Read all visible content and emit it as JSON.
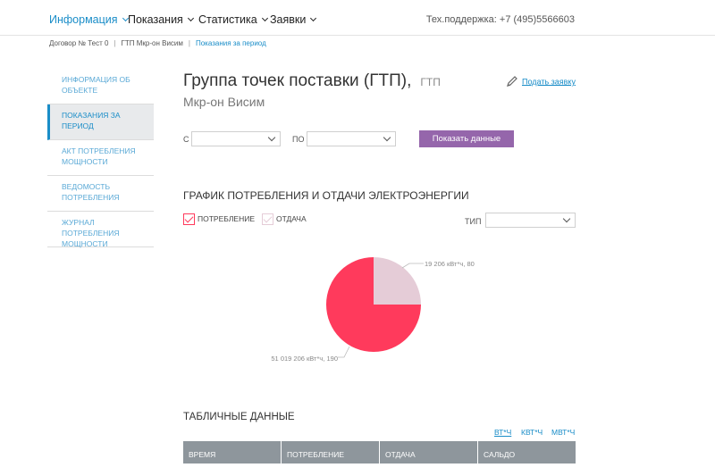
{
  "nav": {
    "items": [
      {
        "label": "Информация",
        "active": true
      },
      {
        "label": "Показания",
        "active": false
      },
      {
        "label": "Статистика",
        "active": false
      },
      {
        "label": "Заявки",
        "active": false
      }
    ],
    "support": "Тех.поддержка: +7 (495)5566603"
  },
  "breadcrumb": [
    "Договор № Тест 0",
    "ГТП Мкр-он Висим",
    "Показания за период"
  ],
  "sidebar": {
    "items": [
      {
        "label": "Информация об объекте"
      },
      {
        "label": "Показания за период"
      },
      {
        "label": "Акт потребления мощности"
      },
      {
        "label": "Ведомость потребления"
      },
      {
        "label": "Журнал потребления мощности"
      }
    ]
  },
  "page": {
    "title": "Группа точек поставки (ГТП),",
    "title_type": "ГТП",
    "subtitle": "Мкр-он Висим",
    "request_link": "Подать заявку"
  },
  "filters": {
    "from_label": "С",
    "to_label": "ПО",
    "from_value": "",
    "to_value": "",
    "show_button": "Показать данные"
  },
  "chart_section": {
    "title": "График потребления и отдачи электроэнергии",
    "legend_consumption": "Потребление",
    "legend_return": "Отдача",
    "type_label": "Тип",
    "type_value": ""
  },
  "chart_data": {
    "type": "pie",
    "slices": [
      {
        "label": "Потребление",
        "value": 51019206,
        "data_label": "51 019 206 кВт*ч, 190",
        "color": "#ff3a5c"
      },
      {
        "label": "Отдача",
        "value": 19206,
        "data_label": "19 206 кВт*ч, 80",
        "color": "#e5ccd7"
      }
    ]
  },
  "table": {
    "title": "Табличные данные",
    "units": [
      "Вт*ч",
      "кВт*ч",
      "МВт*ч"
    ],
    "active_unit": 0,
    "columns": [
      "Время",
      "Потребление",
      "Отдача",
      "Сальдо"
    ]
  },
  "colors": {
    "accent": "#1a8dc8",
    "button": "#9566ab",
    "consumption": "#ff3a5c",
    "return": "#e5ccd7",
    "table_header": "#8e969c"
  }
}
